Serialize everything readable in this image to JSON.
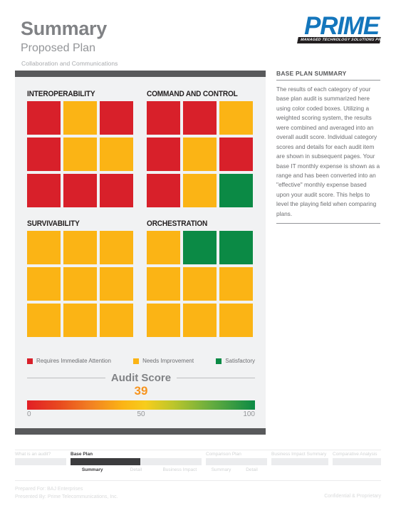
{
  "header": {
    "title": "Summary",
    "subtitle": "Proposed Plan",
    "caption": "Collaboration and Communications"
  },
  "logo": {
    "word": "PRIME",
    "tagline": "MANAGED TECHNOLOGY SOLUTIONS PROVIDER",
    "brand_color": "#1476bc"
  },
  "colors": {
    "red": "#d8202a",
    "yellow": "#fbb415",
    "green": "#0b8a45",
    "panel_bar": "#58595b",
    "panel_bg": "#f1f2f3",
    "score_orange": "#f7941e"
  },
  "categories": [
    {
      "title": "INTEROPERABILITY",
      "cells": [
        "red",
        "yellow",
        "red",
        "red",
        "yellow",
        "yellow",
        "red",
        "red",
        "red"
      ]
    },
    {
      "title": "COMMAND AND CONTROL",
      "cells": [
        "red",
        "red",
        "yellow",
        "red",
        "yellow",
        "red",
        "red",
        "yellow",
        "green"
      ]
    },
    {
      "title": "SURVIVABILITY",
      "cells": [
        "yellow",
        "yellow",
        "yellow",
        "yellow",
        "yellow",
        "yellow",
        "yellow",
        "yellow",
        "yellow"
      ]
    },
    {
      "title": "ORCHESTRATION",
      "cells": [
        "yellow",
        "green",
        "green",
        "yellow",
        "yellow",
        "yellow",
        "yellow",
        "yellow",
        "yellow"
      ]
    }
  ],
  "legend": [
    {
      "label": "Requires Immediate Attention",
      "color": "#d8202a"
    },
    {
      "label": "Needs Improvement",
      "color": "#fbb415"
    },
    {
      "label": "Satisfactory",
      "color": "#0b8a45"
    }
  ],
  "score": {
    "heading": "Audit Score",
    "value": "39",
    "axis_min": "0",
    "axis_mid": "50",
    "axis_max": "100"
  },
  "sidebar": {
    "title": "BASE PLAN SUMMARY",
    "body": "The results of each category of your base plan audit is summarized here using color coded boxes. Utilizing a weighted scoring system, the results were combined and averaged into an overall audit score. Individual category scores and details for each audit item are shown in subsequent pages. Your base IT monthly expense is shown as a range and has been converted into an \"effective\" monthly expense based upon your audit score. This helps to level the playing field when comparing plans."
  },
  "nav": {
    "groups": [
      {
        "label": "What is an audit?",
        "active": false,
        "fill_percent": 0,
        "subitems": []
      },
      {
        "label": "Base Plan",
        "active": true,
        "fill_percent": 53,
        "subitems": [
          {
            "label": "Summary",
            "active": true
          },
          {
            "label": "Detail",
            "active": false
          },
          {
            "label": "Business Impact",
            "active": false
          }
        ]
      },
      {
        "label": "Comparison Plan",
        "active": false,
        "fill_percent": 0,
        "subitems": [
          {
            "label": "Summary",
            "active": false
          },
          {
            "label": "Detail",
            "active": false
          }
        ]
      },
      {
        "label": "Business Impact Summary",
        "active": false,
        "fill_percent": 0,
        "subitems": []
      },
      {
        "label": "Comparative Analysis",
        "active": false,
        "fill_percent": 0,
        "subitems": []
      }
    ]
  },
  "footer": {
    "prepared_for": "Prepared For: BAJ Enterprises",
    "presented_by": "Presented By: Prime Telecommunications, Inc.",
    "confidential": "Confidential & Proprietary"
  }
}
